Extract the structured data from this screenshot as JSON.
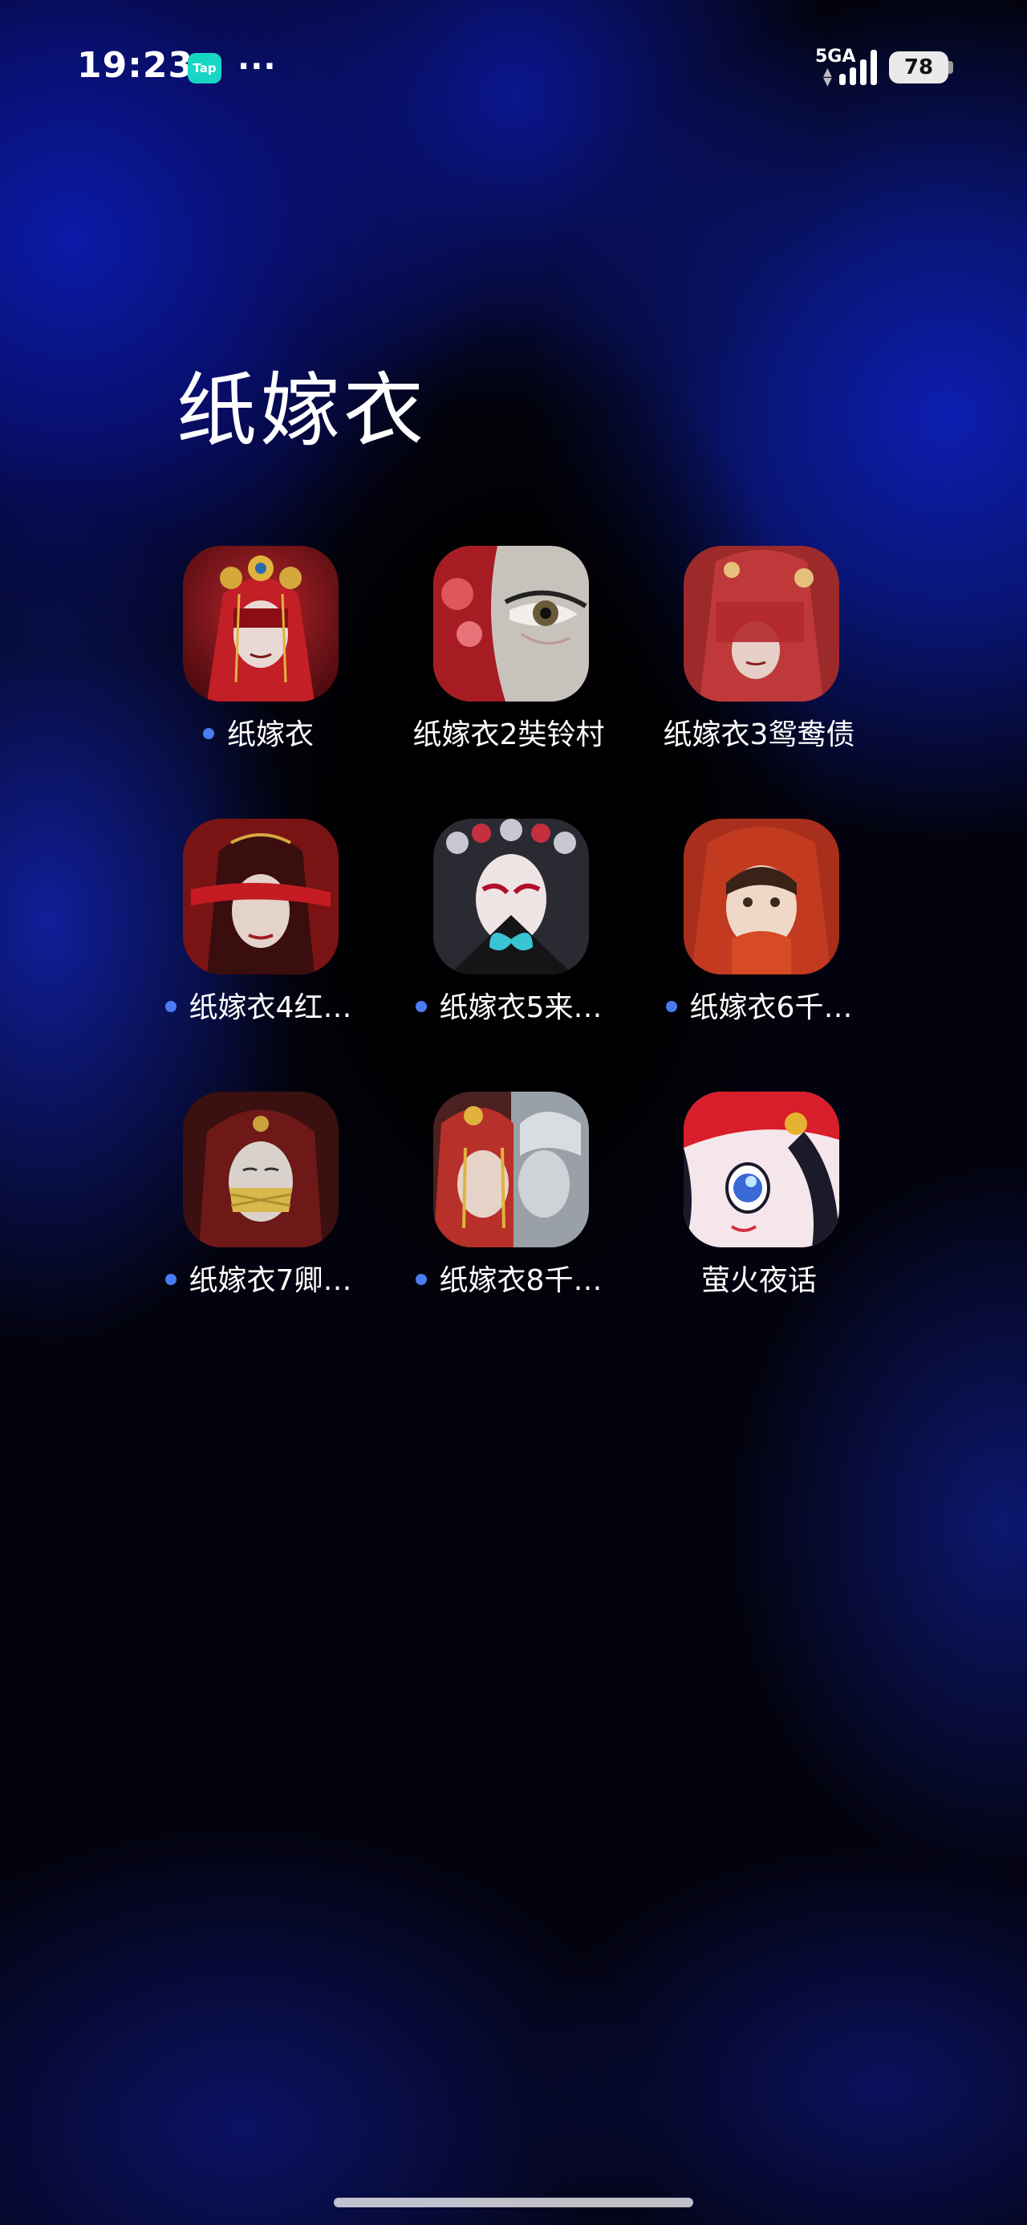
{
  "status_bar": {
    "time": "19:23",
    "tap_badge": "Tap",
    "more": "···",
    "network": "5GA",
    "battery": "78",
    "icons": [
      "tap-app-icon",
      "more-icon",
      "network-icon",
      "signal-icon",
      "battery-icon"
    ]
  },
  "folder": {
    "title": "纸嫁衣",
    "apps": [
      {
        "label": "纸嫁衣",
        "new": true,
        "icon": "bride-red-veil-crown-icon"
      },
      {
        "label": "纸嫁衣2奘铃村",
        "new": false,
        "icon": "opera-mask-eye-icon"
      },
      {
        "label": "纸嫁衣3鸳鸯债",
        "new": false,
        "icon": "veiled-bride-icon"
      },
      {
        "label": "纸嫁衣4红…",
        "new": true,
        "icon": "red-blindfold-icon"
      },
      {
        "label": "纸嫁衣5来…",
        "new": true,
        "icon": "opera-fan-butterfly-icon"
      },
      {
        "label": "纸嫁衣6千…",
        "new": true,
        "icon": "red-hood-girl-icon"
      },
      {
        "label": "纸嫁衣7卿…",
        "new": true,
        "icon": "hooded-gagged-icon"
      },
      {
        "label": "纸嫁衣8千…",
        "new": true,
        "icon": "twin-brides-icon"
      },
      {
        "label": "萤火夜话",
        "new": false,
        "icon": "anime-girl-icon"
      }
    ]
  },
  "colors": {
    "new_dot": "#4b7bf0",
    "tap_badge": "#18d6c4",
    "wallpaper_blue": "#0c1eb0"
  }
}
